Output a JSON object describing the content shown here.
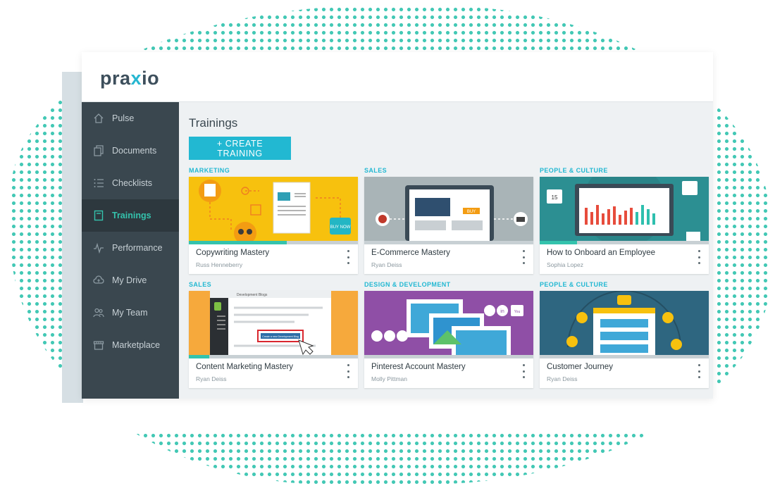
{
  "app": {
    "logo_prefix": "pra",
    "logo_x": "x",
    "logo_suffix": "io"
  },
  "sidebar": {
    "items": [
      {
        "label": "Pulse",
        "icon": "home-icon",
        "active": false
      },
      {
        "label": "Documents",
        "icon": "documents-icon",
        "active": false
      },
      {
        "label": "Checklists",
        "icon": "checklist-icon",
        "active": false
      },
      {
        "label": "Trainings",
        "icon": "trainings-icon",
        "active": true
      },
      {
        "label": "Performance",
        "icon": "pulse-line-icon",
        "active": false
      },
      {
        "label": "My Drive",
        "icon": "cloud-icon",
        "active": false
      },
      {
        "label": "My Team",
        "icon": "team-icon",
        "active": false
      },
      {
        "label": "Marketplace",
        "icon": "store-icon",
        "active": false
      }
    ]
  },
  "main": {
    "title": "Trainings",
    "create_button": "+ CREATE TRAINING",
    "cards": [
      {
        "category": "MARKETING",
        "title": "Copywriting Mastery",
        "author": "Russ Henneberry",
        "progress": 0.58,
        "thumb_color": "#f7c10e",
        "thumb_kind": "marketing"
      },
      {
        "category": "SALES",
        "title": "E-Commerce Mastery",
        "author": "Ryan Deiss",
        "progress": 0.0,
        "thumb_color": "#a9b4b7",
        "thumb_kind": "ecommerce"
      },
      {
        "category": "PEOPLE & CULTURE",
        "title": "How to Onboard an Employee",
        "author": "Sophia Lopez",
        "progress": 0.22,
        "thumb_color": "#2c8f92",
        "thumb_kind": "onboard"
      },
      {
        "category": "SALES",
        "title": "Content Marketing Mastery",
        "author": "Ryan Deiss",
        "progress": 0.12,
        "thumb_color": "#f6a93c",
        "thumb_kind": "content"
      },
      {
        "category": "DESIGN & DEVELOPMENT",
        "title": "Pinterest Account Mastery",
        "author": "Molly Pittman",
        "progress": 0.0,
        "thumb_color": "#8f4fa6",
        "thumb_kind": "pinterest"
      },
      {
        "category": "PEOPLE & CULTURE",
        "title": "Customer Journey",
        "author": "Ryan Deiss",
        "progress": 0.0,
        "thumb_color": "#2e6680",
        "thumb_kind": "journey"
      }
    ]
  },
  "thumb_text": {
    "buy": "BUY",
    "buy_now": "BUY NOW",
    "in_badge": "in",
    "youtube_badge": "You",
    "calendar_day": "15",
    "dev_blogs": "Development Blogs",
    "create_dev_blog": "Create a new Development Blog"
  }
}
